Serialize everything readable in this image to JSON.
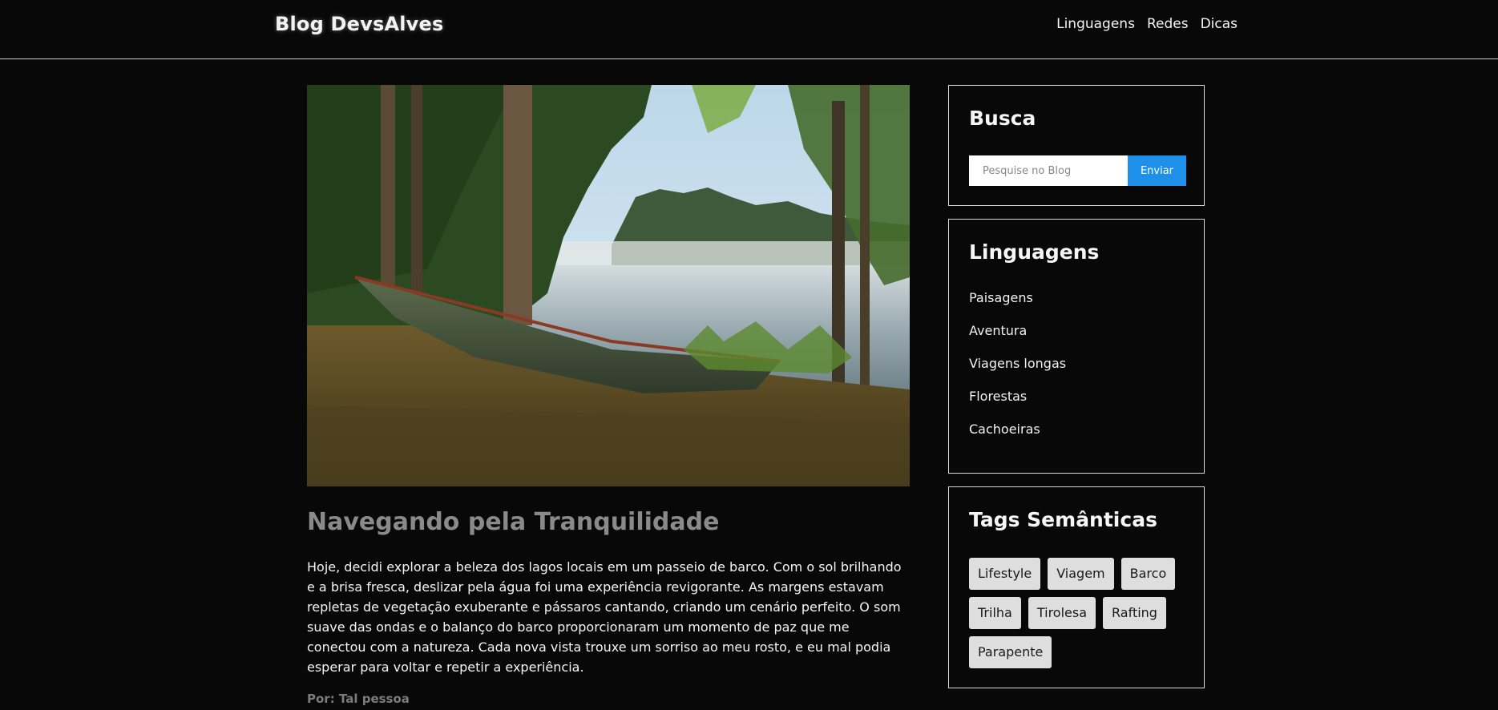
{
  "header": {
    "brand": "Blog DevsAlves",
    "nav": [
      "Linguagens",
      "Redes",
      "Dicas"
    ]
  },
  "post": {
    "title": "Navegando pela Tranquilidade",
    "body": "Hoje, decidi explorar a beleza dos lagos locais em um passeio de barco. Com o sol brilhando e a brisa fresca, deslizar pela água foi uma experiência revigorante. As margens estavam repletas de vegetação exuberante e pássaros cantando, criando um cenário perfeito. O som suave das ondas e o balanço do barco proporcionaram um momento de paz que me conectou com a natureza. Cada nova vista trouxe um sorriso ao meu rosto, e eu mal podia esperar para voltar e repetir a experiência.",
    "author": "Por: Tal pessoa"
  },
  "sidebar": {
    "search": {
      "title": "Busca",
      "placeholder": "Pesquise no Blog",
      "button": "Enviar"
    },
    "languages": {
      "title": "Linguagens",
      "items": [
        "Paisagens",
        "Aventura",
        "Viagens longas",
        "Florestas",
        "Cachoeiras"
      ]
    },
    "tags": {
      "title": "Tags Semânticas",
      "items": [
        "Lifestyle",
        "Viagem",
        "Barco",
        "Trilha",
        "Tirolesa",
        "Rafting",
        "Parapente"
      ]
    }
  },
  "colors": {
    "background": "#080808",
    "accent": "#1e90ea",
    "tag_background": "#dedede",
    "title_gray": "#8a8a8a"
  }
}
